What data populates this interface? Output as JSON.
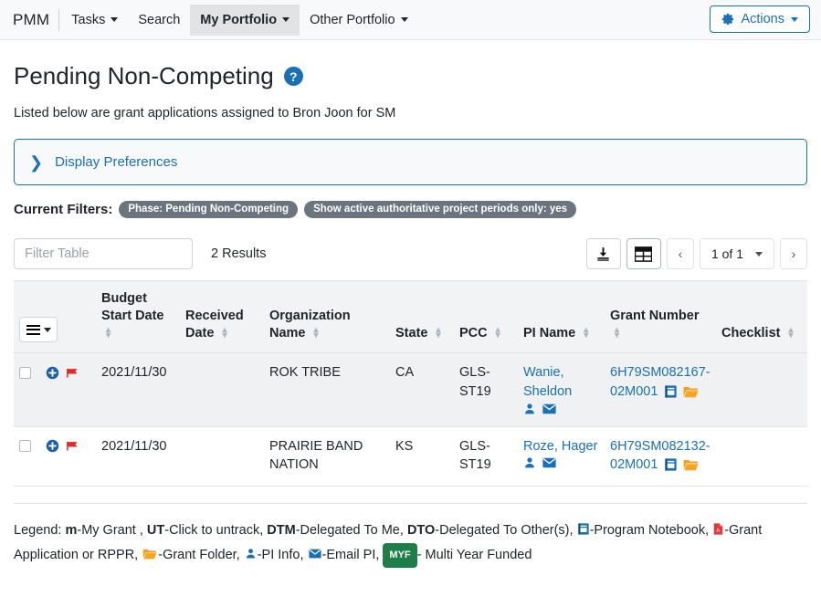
{
  "navbar": {
    "brand": "PMM",
    "items": [
      {
        "label": "Tasks",
        "has_caret": true,
        "active": false
      },
      {
        "label": "Search",
        "has_caret": false,
        "active": false
      },
      {
        "label": "My Portfolio",
        "has_caret": true,
        "active": true
      },
      {
        "label": "Other Portfolio",
        "has_caret": true,
        "active": false
      }
    ],
    "actions_button": "Actions",
    "actions_icon": "gear-icon",
    "accent_color": "#1a6fb5"
  },
  "header": {
    "title": "Pending Non-Competing",
    "help_icon": "question-circle-icon",
    "subtitle": "Listed below are grant applications assigned to Bron Joon for SM"
  },
  "display_preferences": {
    "label": "Display Preferences",
    "chevron_icon": "chevron-right-icon",
    "expanded": false
  },
  "current_filters": {
    "label": "Current Filters:",
    "pills": [
      "Phase: Pending Non-Competing",
      "Show active authoritative project periods only: yes"
    ],
    "pill_color": "#6c757d"
  },
  "toolbar": {
    "filter_placeholder": "Filter Table",
    "filter_value": "",
    "results_text": "2 Results",
    "download_icon": "download-icon",
    "grid_icon": "table-grid-icon",
    "prev_label": "‹",
    "next_label": "›",
    "page_indicator": "1 of 1"
  },
  "table": {
    "menu_icon": "hamburger-menu-icon",
    "columns": [
      {
        "label": "",
        "sortable": false
      },
      {
        "label": "Budget Start Date",
        "sortable": true
      },
      {
        "label": "Received Date",
        "sortable": true
      },
      {
        "label": "Organization Name",
        "sortable": true
      },
      {
        "label": "State",
        "sortable": true
      },
      {
        "label": "PCC",
        "sortable": true
      },
      {
        "label": "PI Name",
        "sortable": true
      },
      {
        "label": "Grant Number",
        "sortable": true
      },
      {
        "label": "Checklist",
        "sortable": true
      }
    ],
    "rows": [
      {
        "checkbox": false,
        "row_icons": [
          "plus-circle-icon",
          "red-flag-icon"
        ],
        "budget_start_date": "2021/11/30",
        "received_date": "",
        "organization_name": "ROK TRIBE",
        "state": "CA",
        "pcc": "GLS-ST19",
        "pi_name": "Wanie, Sheldon",
        "pi_icons": [
          "pi-info-icon",
          "email-pi-icon"
        ],
        "grant_number": "6H79SM082167-02M001",
        "grant_icons": [
          "program-notebook-icon",
          "grant-folder-icon"
        ],
        "checklist": ""
      },
      {
        "checkbox": false,
        "row_icons": [
          "plus-circle-icon",
          "red-flag-icon"
        ],
        "budget_start_date": "2021/11/30",
        "received_date": "",
        "organization_name": "PRAIRIE BAND NATION",
        "state": "KS",
        "pcc": "GLS-ST19",
        "pi_name": "Roze, Hager",
        "pi_icons": [
          "pi-info-icon",
          "email-pi-icon"
        ],
        "grant_number": "6H79SM082132-02M001",
        "grant_icons": [
          "program-notebook-icon",
          "grant-folder-icon"
        ],
        "checklist": ""
      }
    ]
  },
  "legend": {
    "title": "Legend:",
    "my_grant_key": "m",
    "my_grant_text": "-My Grant ,",
    "untrack_key": "UT",
    "untrack_text": "-Click to untrack,",
    "dtm_key": "DTM",
    "dtm_text": "-Delegated To Me,",
    "dto_key": "DTO",
    "dto_text": "-Delegated To Other(s),",
    "notebook_text": "-Program Notebook,",
    "pdf_text": "-Grant Application or RPPR,",
    "folder_text": "-Grant Folder,",
    "pi_text": "-PI Info,",
    "email_text": "-Email PI,",
    "myf_badge": "MYF",
    "myf_text": "- Multi Year Funded"
  }
}
